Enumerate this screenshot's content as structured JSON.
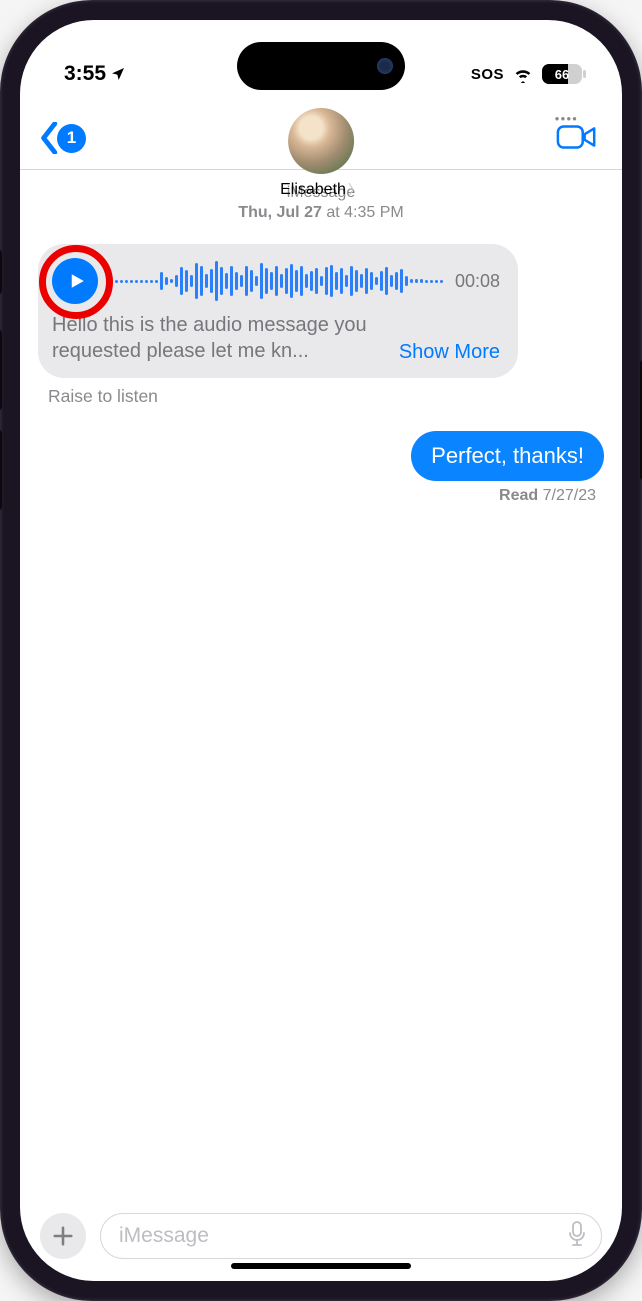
{
  "status": {
    "time": "3:55",
    "location_arrow": "➤",
    "sos": "SOS",
    "battery_pct": "66"
  },
  "nav": {
    "back_badge": "1",
    "contact_name": "Elisabeth"
  },
  "thread": {
    "service": "iMessage",
    "timestamp_day": "Thu, Jul 27",
    "timestamp_time": " at 4:35 PM"
  },
  "audio": {
    "duration": "00:08",
    "transcript": "Hello this is the audio message you requested please let me kn...",
    "show_more": "Show More"
  },
  "hint_raise": "Raise to listen",
  "outgoing": {
    "text": "Perfect, thanks!",
    "read_label": "Read",
    "read_date": " 7/27/23"
  },
  "composer": {
    "placeholder": "iMessage"
  },
  "waveform_heights": [
    3,
    3,
    3,
    3,
    3,
    3,
    3,
    3,
    3,
    3,
    18,
    8,
    4,
    12,
    28,
    22,
    12,
    36,
    30,
    14,
    24,
    40,
    28,
    16,
    30,
    18,
    12,
    30,
    22,
    10,
    36,
    26,
    18,
    30,
    14,
    26,
    34,
    22,
    30,
    14,
    20,
    26,
    10,
    28,
    32,
    18,
    26,
    12,
    30,
    22,
    14,
    26,
    18,
    8,
    20,
    28,
    12,
    18,
    24,
    10,
    4,
    4,
    4,
    3,
    3,
    3,
    3
  ]
}
